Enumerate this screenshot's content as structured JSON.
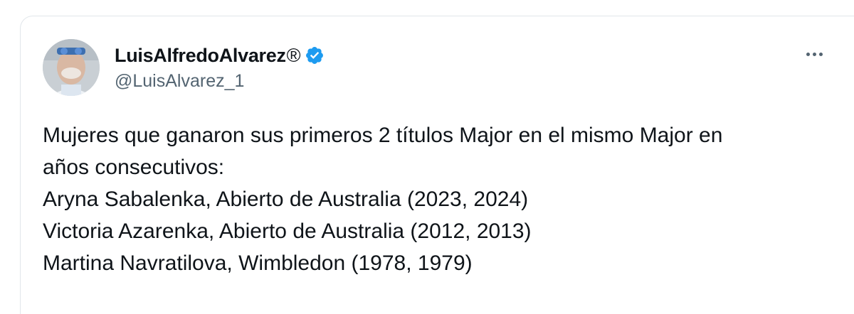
{
  "tweet": {
    "author": {
      "display_name": "LuisAlfredoAlvarez",
      "registered_mark": "®",
      "handle": "@LuisAlvarez_1",
      "verified": true,
      "verified_color": "#1d9bf0"
    },
    "more_icon": "ellipsis-icon",
    "text_lines": [
      "Mujeres que ganaron sus primeros 2 títulos Major en el mismo Major en",
      "años consecutivos:",
      "Aryna Sabalenka, Abierto de Australia (2023, 2024)",
      "Victoria Azarenka, Abierto de Australia (2012, 2013)",
      "Martina Navratilova, Wimbledon (1978, 1979)"
    ]
  }
}
